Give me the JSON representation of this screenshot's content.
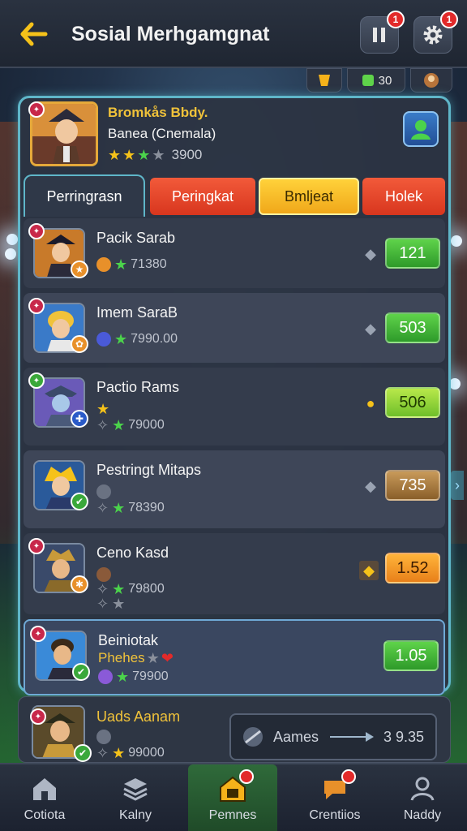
{
  "header": {
    "title": "Sosial Merhgamgnat",
    "badge_left": "1",
    "badge_right": "1"
  },
  "currency": {
    "item2_value": "30"
  },
  "profile": {
    "name": "Bromkås Bbdy.",
    "subtitle": "Banea (Cnemala)",
    "score": "3900"
  },
  "tabs": [
    "Perringrasn",
    "Peringkat",
    "Bmljeat",
    "Holek"
  ],
  "rows": [
    {
      "name": "Pacik Sarab",
      "score": "71380",
      "value": "121"
    },
    {
      "name": "Imem SaraB",
      "score": "7990.00",
      "value": "503"
    },
    {
      "name": "Pactio Rams",
      "score": "79000",
      "value": "506"
    },
    {
      "name": "Pestringt Mitaps",
      "score": "78390",
      "value": "735"
    },
    {
      "name": "Ceno Kasd",
      "score": "79800",
      "value": "1.52"
    },
    {
      "name": "Beiniotak",
      "name2": "Phehes",
      "score": "79900",
      "value": "1.05"
    }
  ],
  "last_row": {
    "name": "Uads Aanam",
    "score": "99000",
    "games_label": "Aames",
    "games_value": "3 9.35"
  },
  "nav": [
    "Cotiota",
    "Kalny",
    "Pemnes",
    "Crentiios",
    "Naddy"
  ],
  "colors": {
    "accent": "#5fb6c9",
    "gold": "#f0c23a",
    "tab_active_yellow": "#ffd23a",
    "tab_red": "#f25a3a",
    "pill_green": "#5fd34a"
  }
}
